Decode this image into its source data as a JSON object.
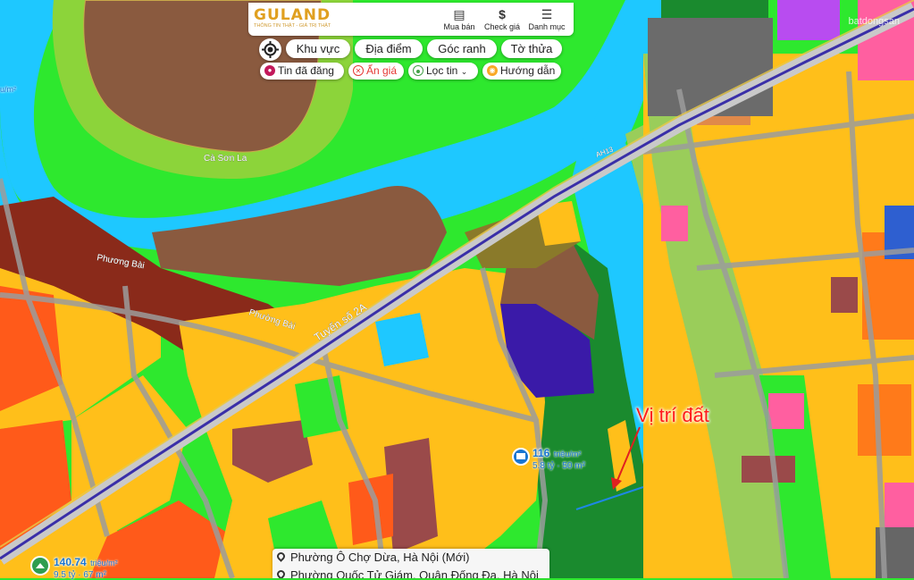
{
  "app": {
    "logo": "GULAND",
    "logo_tagline": "THÔNG TIN THẬT - GIÁ TRỊ THẬT",
    "nav": [
      {
        "label": "Mua bán",
        "icon": "building-icon"
      },
      {
        "label": "Check giá",
        "icon": "dollar-icon"
      },
      {
        "label": "Danh mục",
        "icon": "menu-icon"
      }
    ]
  },
  "toolbar": {
    "row1": [
      "Khu vực",
      "Địa điểm",
      "Góc ranh",
      "Tờ thửa"
    ],
    "row2": [
      {
        "label": "Tin đã đăng",
        "icon": "post-icon",
        "color": "#c2185b"
      },
      {
        "label": "Ẩn giá",
        "icon": "hide-price-icon",
        "color": "#e53935"
      },
      {
        "label": "Lọc tin",
        "icon": "filter-icon",
        "color": "#43a047"
      },
      {
        "label": "Hướng dẫn",
        "icon": "guide-icon",
        "color": "#f9a825"
      }
    ]
  },
  "map": {
    "road_labels": [
      "Tuyến số 2A",
      "Phương Bài",
      "Phường Bài",
      "Cà Sơn La",
      "AH13"
    ],
    "listings": [
      {
        "price": "116",
        "unit": "triệu/m²",
        "detail": "5.8 tỷ · 50 m²"
      },
      {
        "price": "140.74",
        "unit": "triệu/m²",
        "detail": "9.5 tỷ · 67 m²"
      }
    ],
    "partial_label": "u/m²",
    "annotation": "Vị trí đất",
    "watermark": "batdongsan"
  },
  "address_panel": {
    "lines": [
      "Phường Ô Chợ Dừa, Hà Nội (Mới)",
      "Phường Quốc Tử Giám, Quận Đống Đa, Hà Nội"
    ]
  },
  "colors": {
    "river": "#1ec8ff",
    "green_land": "#2ee82e",
    "residential": "#ffb300",
    "brown_land": "#7a4a3a",
    "road_blue": "#3a2fa8",
    "annotation_red": "#ff1a1a"
  }
}
